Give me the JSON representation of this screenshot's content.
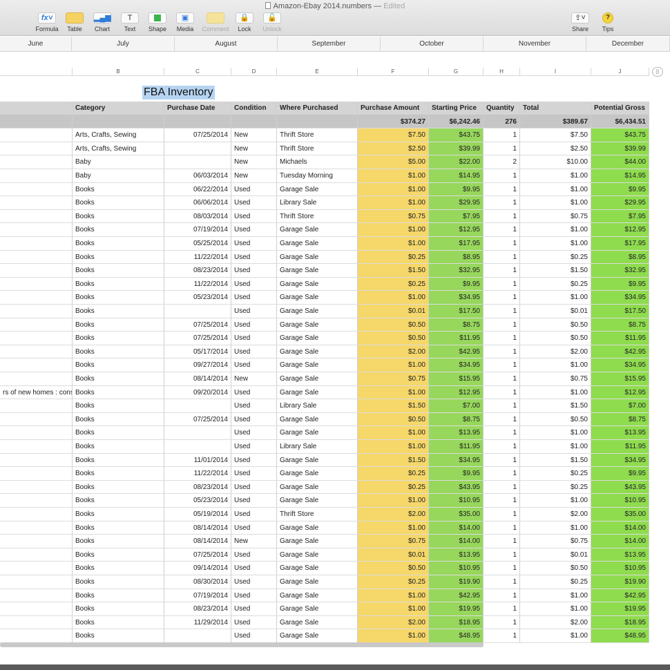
{
  "window": {
    "title": "Amazon-Ebay 2014.numbers",
    "status": "Edited"
  },
  "toolbar": {
    "left": [
      {
        "label": "Formula",
        "glyph": "fx˅",
        "icon": "fx-icon",
        "enabled": true
      },
      {
        "label": "Table",
        "glyph": "",
        "icon": "table-icon",
        "enabled": true
      },
      {
        "label": "Chart",
        "glyph": "▂▄▆",
        "icon": "chart-icon",
        "enabled": true
      },
      {
        "label": "Text",
        "glyph": "T",
        "icon": "text-icon",
        "enabled": true
      },
      {
        "label": "Shape",
        "glyph": "",
        "icon": "shape-icon",
        "enabled": true
      },
      {
        "label": "Media",
        "glyph": "▣",
        "icon": "media-icon",
        "enabled": true
      },
      {
        "label": "Comment",
        "glyph": "",
        "icon": "comment-icon",
        "enabled": false
      },
      {
        "label": "Lock",
        "glyph": "🔒",
        "icon": "lock-icon",
        "enabled": true
      },
      {
        "label": "Unlock",
        "glyph": "🔓",
        "icon": "unlock-icon",
        "enabled": false
      }
    ],
    "right": [
      {
        "label": "Share",
        "glyph": "⇪˅",
        "icon": "share-icon"
      },
      {
        "label": "Tips",
        "glyph": "?",
        "icon": "tips-icon"
      }
    ]
  },
  "months": [
    "June",
    "July",
    "August",
    "September",
    "October",
    "November",
    "December"
  ],
  "column_letters": [
    "",
    "B",
    "C",
    "D",
    "E",
    "F",
    "G",
    "H",
    "I",
    "J"
  ],
  "sheet": {
    "title": "FBA Inventory",
    "headers": [
      "",
      "Category",
      "Purchase Date",
      "Condition",
      "Where Purchased",
      "Purchase Amount",
      "Starting Price",
      "Quantity",
      "Total",
      "Potential Gross"
    ],
    "totals": [
      "",
      "",
      "",
      "",
      "",
      "$374.27",
      "$6,242.46",
      "276",
      "$389.67",
      "$6,434.51"
    ],
    "rows": [
      [
        "",
        "Arts, Crafts, Sewing",
        "07/25/2014",
        "New",
        "Thrift Store",
        "$7.50",
        "$43.75",
        "1",
        "$7.50",
        "$43.75"
      ],
      [
        "",
        "Arts, Crafts, Sewing",
        "",
        "New",
        "Thrift Store",
        "$2.50",
        "$39.99",
        "1",
        "$2.50",
        "$39.99"
      ],
      [
        "",
        "Baby",
        "",
        "New",
        "Michaels",
        "$5.00",
        "$22.00",
        "2",
        "$10.00",
        "$44.00"
      ],
      [
        "",
        "Baby",
        "06/03/2014",
        "New",
        "Tuesday Morning",
        "$1.00",
        "$14.95",
        "1",
        "$1.00",
        "$14.95"
      ],
      [
        "",
        "Books",
        "06/22/2014",
        "Used",
        "Garage Sale",
        "$1.00",
        "$9.95",
        "1",
        "$1.00",
        "$9.95"
      ],
      [
        "",
        "Books",
        "06/06/2014",
        "Used",
        "Library Sale",
        "$1.00",
        "$29.95",
        "1",
        "$1.00",
        "$29.95"
      ],
      [
        "",
        "Books",
        "08/03/2014",
        "Used",
        "Thrift Store",
        "$0.75",
        "$7.95",
        "1",
        "$0.75",
        "$7.95"
      ],
      [
        "",
        "Books",
        "07/19/2014",
        "Used",
        "Garage Sale",
        "$1.00",
        "$12.95",
        "1",
        "$1.00",
        "$12.95"
      ],
      [
        "",
        "Books",
        "05/25/2014",
        "Used",
        "Garage Sale",
        "$1.00",
        "$17.95",
        "1",
        "$1.00",
        "$17.95"
      ],
      [
        "",
        "Books",
        "11/22/2014",
        "Used",
        "Garage Sale",
        "$0.25",
        "$8.95",
        "1",
        "$0.25",
        "$8.95"
      ],
      [
        "",
        "Books",
        "08/23/2014",
        "Used",
        "Garage Sale",
        "$1.50",
        "$32.95",
        "1",
        "$1.50",
        "$32.95"
      ],
      [
        "",
        "Books",
        "11/22/2014",
        "Used",
        "Garage Sale",
        "$0.25",
        "$9.95",
        "1",
        "$0.25",
        "$9.95"
      ],
      [
        "",
        "Books",
        "05/23/2014",
        "Used",
        "Garage Sale",
        "$1.00",
        "$34.95",
        "1",
        "$1.00",
        "$34.95"
      ],
      [
        "",
        "Books",
        "",
        "Used",
        "Garage Sale",
        "$0.01",
        "$17.50",
        "1",
        "$0.01",
        "$17.50"
      ],
      [
        "",
        "Books",
        "07/25/2014",
        "Used",
        "Garage Sale",
        "$0.50",
        "$8.75",
        "1",
        "$0.50",
        "$8.75"
      ],
      [
        "",
        "Books",
        "07/25/2014",
        "Used",
        "Garage Sale",
        "$0.50",
        "$11.95",
        "1",
        "$0.50",
        "$11.95"
      ],
      [
        "",
        "Books",
        "05/17/2014",
        "Used",
        "Garage Sale",
        "$2.00",
        "$42.95",
        "1",
        "$2.00",
        "$42.95"
      ],
      [
        "",
        "Books",
        "09/27/2014",
        "Used",
        "Garage Sale",
        "$1.00",
        "$34.95",
        "1",
        "$1.00",
        "$34.95"
      ],
      [
        "",
        "Books",
        "08/14/2014",
        "New",
        "Garage Sale",
        "$0.75",
        "$15.95",
        "1",
        "$0.75",
        "$15.95"
      ],
      [
        "rs of new homes : constr",
        "Books",
        "09/20/2014",
        "Used",
        "Garage Sale",
        "$1.00",
        "$12.95",
        "1",
        "$1.00",
        "$12.95"
      ],
      [
        "",
        "Books",
        "",
        "Used",
        "Library Sale",
        "$1.50",
        "$7.00",
        "1",
        "$1.50",
        "$7.00"
      ],
      [
        "",
        "Books",
        "07/25/2014",
        "Used",
        "Garage Sale",
        "$0.50",
        "$8.75",
        "1",
        "$0.50",
        "$8.75"
      ],
      [
        "",
        "Books",
        "",
        "Used",
        "Garage Sale",
        "$1.00",
        "$13.95",
        "1",
        "$1.00",
        "$13.95"
      ],
      [
        "",
        "Books",
        "",
        "Used",
        "Library Sale",
        "$1.00",
        "$11.95",
        "1",
        "$1.00",
        "$11.95"
      ],
      [
        "",
        "Books",
        "11/01/2014",
        "Used",
        "Garage Sale",
        "$1.50",
        "$34.95",
        "1",
        "$1.50",
        "$34.95"
      ],
      [
        "",
        "Books",
        "11/22/2014",
        "Used",
        "Garage Sale",
        "$0.25",
        "$9.95",
        "1",
        "$0.25",
        "$9.95"
      ],
      [
        "",
        "Books",
        "08/23/2014",
        "Used",
        "Garage Sale",
        "$0.25",
        "$43.95",
        "1",
        "$0.25",
        "$43.95"
      ],
      [
        "",
        "Books",
        "05/23/2014",
        "Used",
        "Garage Sale",
        "$1.00",
        "$10.95",
        "1",
        "$1.00",
        "$10.95"
      ],
      [
        "",
        "Books",
        "05/19/2014",
        "Used",
        "Thrift Store",
        "$2.00",
        "$35.00",
        "1",
        "$2.00",
        "$35.00"
      ],
      [
        "",
        "Books",
        "08/14/2014",
        "Used",
        "Garage Sale",
        "$1.00",
        "$14.00",
        "1",
        "$1.00",
        "$14.00"
      ],
      [
        "",
        "Books",
        "08/14/2014",
        "New",
        "Garage Sale",
        "$0.75",
        "$14.00",
        "1",
        "$0.75",
        "$14.00"
      ],
      [
        "",
        "Books",
        "07/25/2014",
        "Used",
        "Garage Sale",
        "$0.01",
        "$13.95",
        "1",
        "$0.01",
        "$13.95"
      ],
      [
        "",
        "Books",
        "09/14/2014",
        "Used",
        "Garage Sale",
        "$0.50",
        "$10.95",
        "1",
        "$0.50",
        "$10.95"
      ],
      [
        "",
        "Books",
        "08/30/2014",
        "Used",
        "Garage Sale",
        "$0.25",
        "$19.90",
        "1",
        "$0.25",
        "$19.90"
      ],
      [
        "",
        "Books",
        "07/19/2014",
        "Used",
        "Garage Sale",
        "$1.00",
        "$42.95",
        "1",
        "$1.00",
        "$42.95"
      ],
      [
        "",
        "Books",
        "08/23/2014",
        "Used",
        "Garage Sale",
        "$1.00",
        "$19.95",
        "1",
        "$1.00",
        "$19.95"
      ],
      [
        "",
        "Books",
        "11/29/2014",
        "Used",
        "Garage Sale",
        "$2.00",
        "$18.95",
        "1",
        "$2.00",
        "$18.95"
      ],
      [
        "",
        "Books",
        "",
        "Used",
        "Garage Sale",
        "$1.00",
        "$48.95",
        "1",
        "$1.00",
        "$48.95"
      ]
    ]
  },
  "colors": {
    "purchase_amount": "#f5d76a",
    "starting_price": "#97d75c",
    "potential_gross": "#8fdc4f",
    "title_highlight": "#b6d4f2"
  }
}
